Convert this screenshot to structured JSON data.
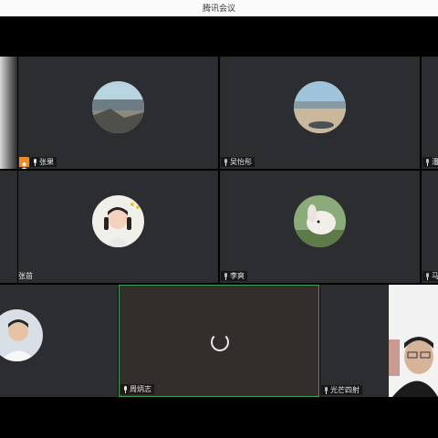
{
  "window": {
    "title": "腾讯会议"
  },
  "participants": {
    "row1_left": {
      "name": ""
    },
    "row1_1": {
      "name": "张果"
    },
    "row1_2": {
      "name": "吴怡彤"
    },
    "row1_3": {
      "name": "潘"
    },
    "row2_1": {
      "name": "张苗"
    },
    "row2_2": {
      "name": "李爽"
    },
    "row2_3": {
      "name": "马"
    },
    "row3_1": {
      "name": ""
    },
    "row3_2": {
      "name": "周炳志"
    },
    "row3_3": {
      "name": "光芒四射"
    }
  },
  "icons": {
    "mic": "microphone-icon",
    "host": "host-badge-icon",
    "loading": "loading-spinner-icon"
  },
  "colors": {
    "tile_bg": "#2b2d30",
    "active_border": "#3fa35a",
    "host_badge": "#f08a24"
  }
}
